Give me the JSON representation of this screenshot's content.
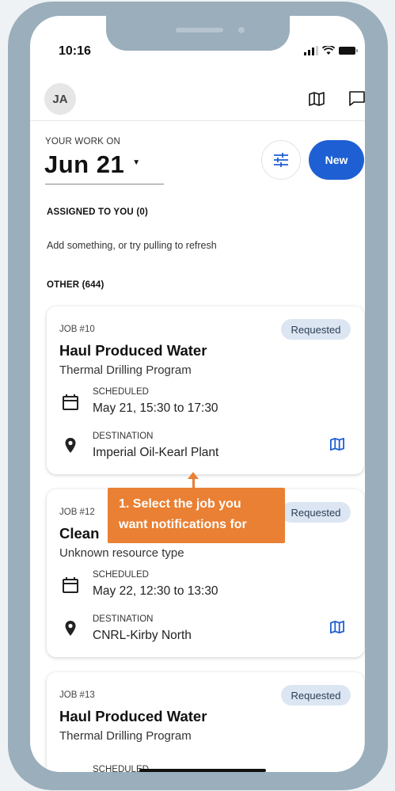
{
  "status_bar": {
    "time": "10:16"
  },
  "header": {
    "avatar_initials": "JA"
  },
  "work": {
    "label": "YOUR WORK ON",
    "date": "Jun 21",
    "new_button": "New"
  },
  "assigned": {
    "title": "ASSIGNED TO YOU (0)",
    "empty_hint": "Add something, or try pulling to refresh"
  },
  "other": {
    "title": "OTHER (644)"
  },
  "jobs": [
    {
      "number": "JOB #10",
      "status": "Requested",
      "title": "Haul Produced Water",
      "subtitle": "Thermal Drilling Program",
      "scheduled_label": "SCHEDULED",
      "scheduled_value": "May 21, 15:30 to 17:30",
      "destination_label": "DESTINATION",
      "destination_value": "Imperial Oil-Kearl Plant"
    },
    {
      "number": "JOB #12",
      "status": "Requested",
      "title": "Clean",
      "subtitle": "Unknown resource type",
      "scheduled_label": "SCHEDULED",
      "scheduled_value": "May 22, 12:30 to 13:30",
      "destination_label": "DESTINATION",
      "destination_value": "CNRL-Kirby North"
    },
    {
      "number": "JOB #13",
      "status": "Requested",
      "title": "Haul Produced Water",
      "subtitle": "Thermal Drilling Program",
      "scheduled_label": "SCHEDULED"
    }
  ],
  "tooltip": {
    "line1": "1. Select the job you",
    "line2": "want notifications for"
  },
  "colors": {
    "frame": "#9aaebc",
    "primary": "#1e5fd4",
    "badge_bg": "#dce6f3",
    "tooltip": "#e98033"
  }
}
